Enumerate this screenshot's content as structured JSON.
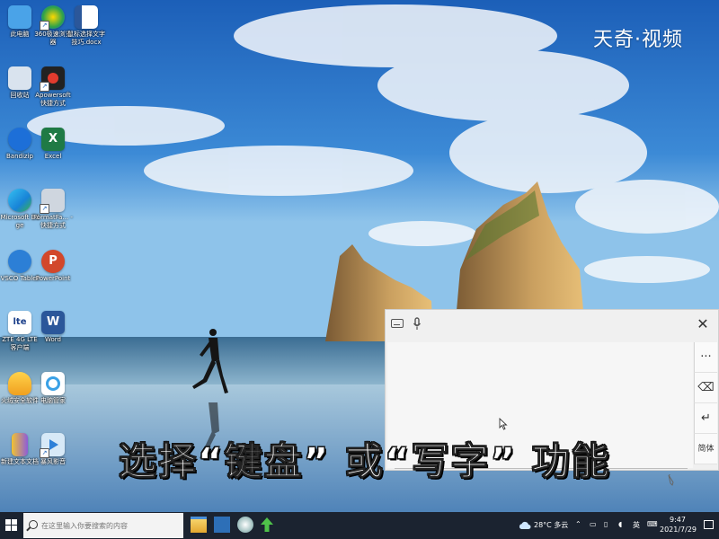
{
  "watermark": "天奇·视频",
  "caption": "选择“键盘” 或“写字” 功能",
  "desktop_icons": [
    {
      "label": "此电脑",
      "icon": "this-pc-icon",
      "color": "#4aa3e8"
    },
    {
      "label": "360极速浏览器",
      "icon": "360-browser-icon",
      "color": "#2ea24a"
    },
    {
      "label": "鼠标选择文字技巧.docx",
      "icon": "word-doc-icon",
      "color": "#2b579a"
    },
    {
      "label": "回收站",
      "icon": "recycle-bin-icon",
      "color": "#d9e3ee"
    },
    {
      "label": "Apowersoft 快捷方式",
      "icon": "apowersoft-icon",
      "color": "#e23b2e"
    },
    {
      "label": "Bandizip",
      "icon": "bandizip-icon",
      "color": "#1d6fd8"
    },
    {
      "label": "Excel",
      "icon": "excel-icon",
      "color": "#1f7a45"
    },
    {
      "label": "Microsoft Edge",
      "icon": "edge-icon",
      "color": "#1883d7"
    },
    {
      "label": "FormatFa... - 快捷方式",
      "icon": "formatfactory-icon",
      "color": "#cfd6df"
    },
    {
      "label": "VSCO Tablet",
      "icon": "vsco-icon",
      "color": "#2c7fd6"
    },
    {
      "label": "PowerPoint",
      "icon": "powerpoint-icon",
      "color": "#d2472b"
    },
    {
      "label": "ZTE 4G LTE 客户端",
      "icon": "zte-lte-icon",
      "color": "#ffffff"
    },
    {
      "label": "Word",
      "icon": "word-icon",
      "color": "#2b579a"
    },
    {
      "label": "火绒安全软件",
      "icon": "huorong-icon",
      "color": "#f0a020"
    },
    {
      "label": "电脑管家",
      "icon": "pc-manager-icon",
      "color": "#3aa1e6"
    },
    {
      "label": "新建文本文档",
      "icon": "text-file-icon",
      "color": "#f1c232"
    },
    {
      "label": "暴风影音",
      "icon": "video-player-icon",
      "color": "#2d80d8"
    }
  ],
  "keyboard_panel": {
    "top_icons": [
      "keyboard-settings-icon",
      "microphone-icon"
    ],
    "close_label": "✕",
    "side_buttons": [
      {
        "label": "···",
        "name": "more-options-button"
      },
      {
        "label": "⌫",
        "name": "backspace-button"
      },
      {
        "label": "↵",
        "name": "enter-button"
      },
      {
        "label": "简体",
        "name": "simplified-chinese-button"
      }
    ]
  },
  "taskbar": {
    "search_placeholder": "在这里输入你要搜索的内容",
    "weather": "28°C 多云",
    "ime": "英",
    "time": "9:47",
    "date": "2021/7/29",
    "pinned": [
      "file-explorer-icon",
      "app-store-icon",
      "browser-icon",
      "arrow-up-icon"
    ],
    "colors": {
      "bar": "#1b2330"
    }
  }
}
